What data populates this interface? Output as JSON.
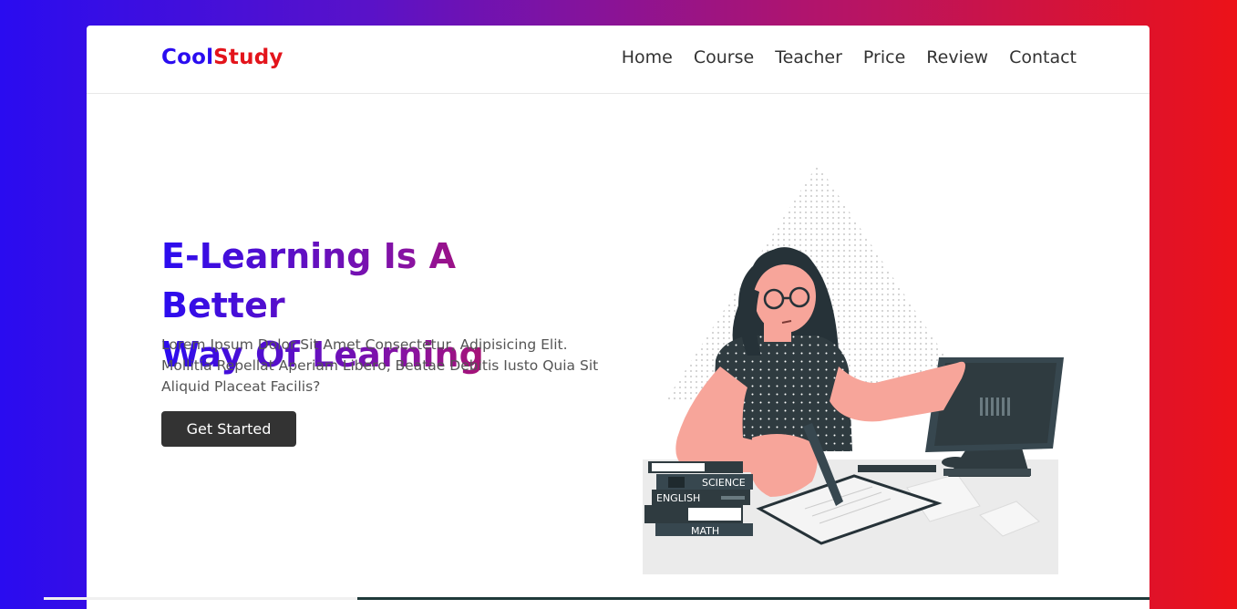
{
  "logo": {
    "part1": "Cool",
    "part2": "Study"
  },
  "nav": [
    "Home",
    "Course",
    "Teacher",
    "Price",
    "Review",
    "Contact"
  ],
  "hero": {
    "title_line1": "E-Learning Is A Better",
    "title_line2": "Way Of Learning",
    "text": "Lorem Ipsum Dolor Sit Amet Consectetur, Adipisicing Elit. Mollitia Repellat Aperiam Libero, Beatae Debitis Iusto Quia Sit Aliquid Placeat Facilis?",
    "button": "Get Started"
  },
  "illustration": {
    "books": [
      "SCIENCE",
      "ENGLISH",
      "MATH"
    ]
  },
  "colors": {
    "brand_blue": "#2a0cf0",
    "brand_red": "#e3141b",
    "dark": "#333333",
    "skin": "#f7a59a",
    "dark_slate": "#2f3b40"
  }
}
